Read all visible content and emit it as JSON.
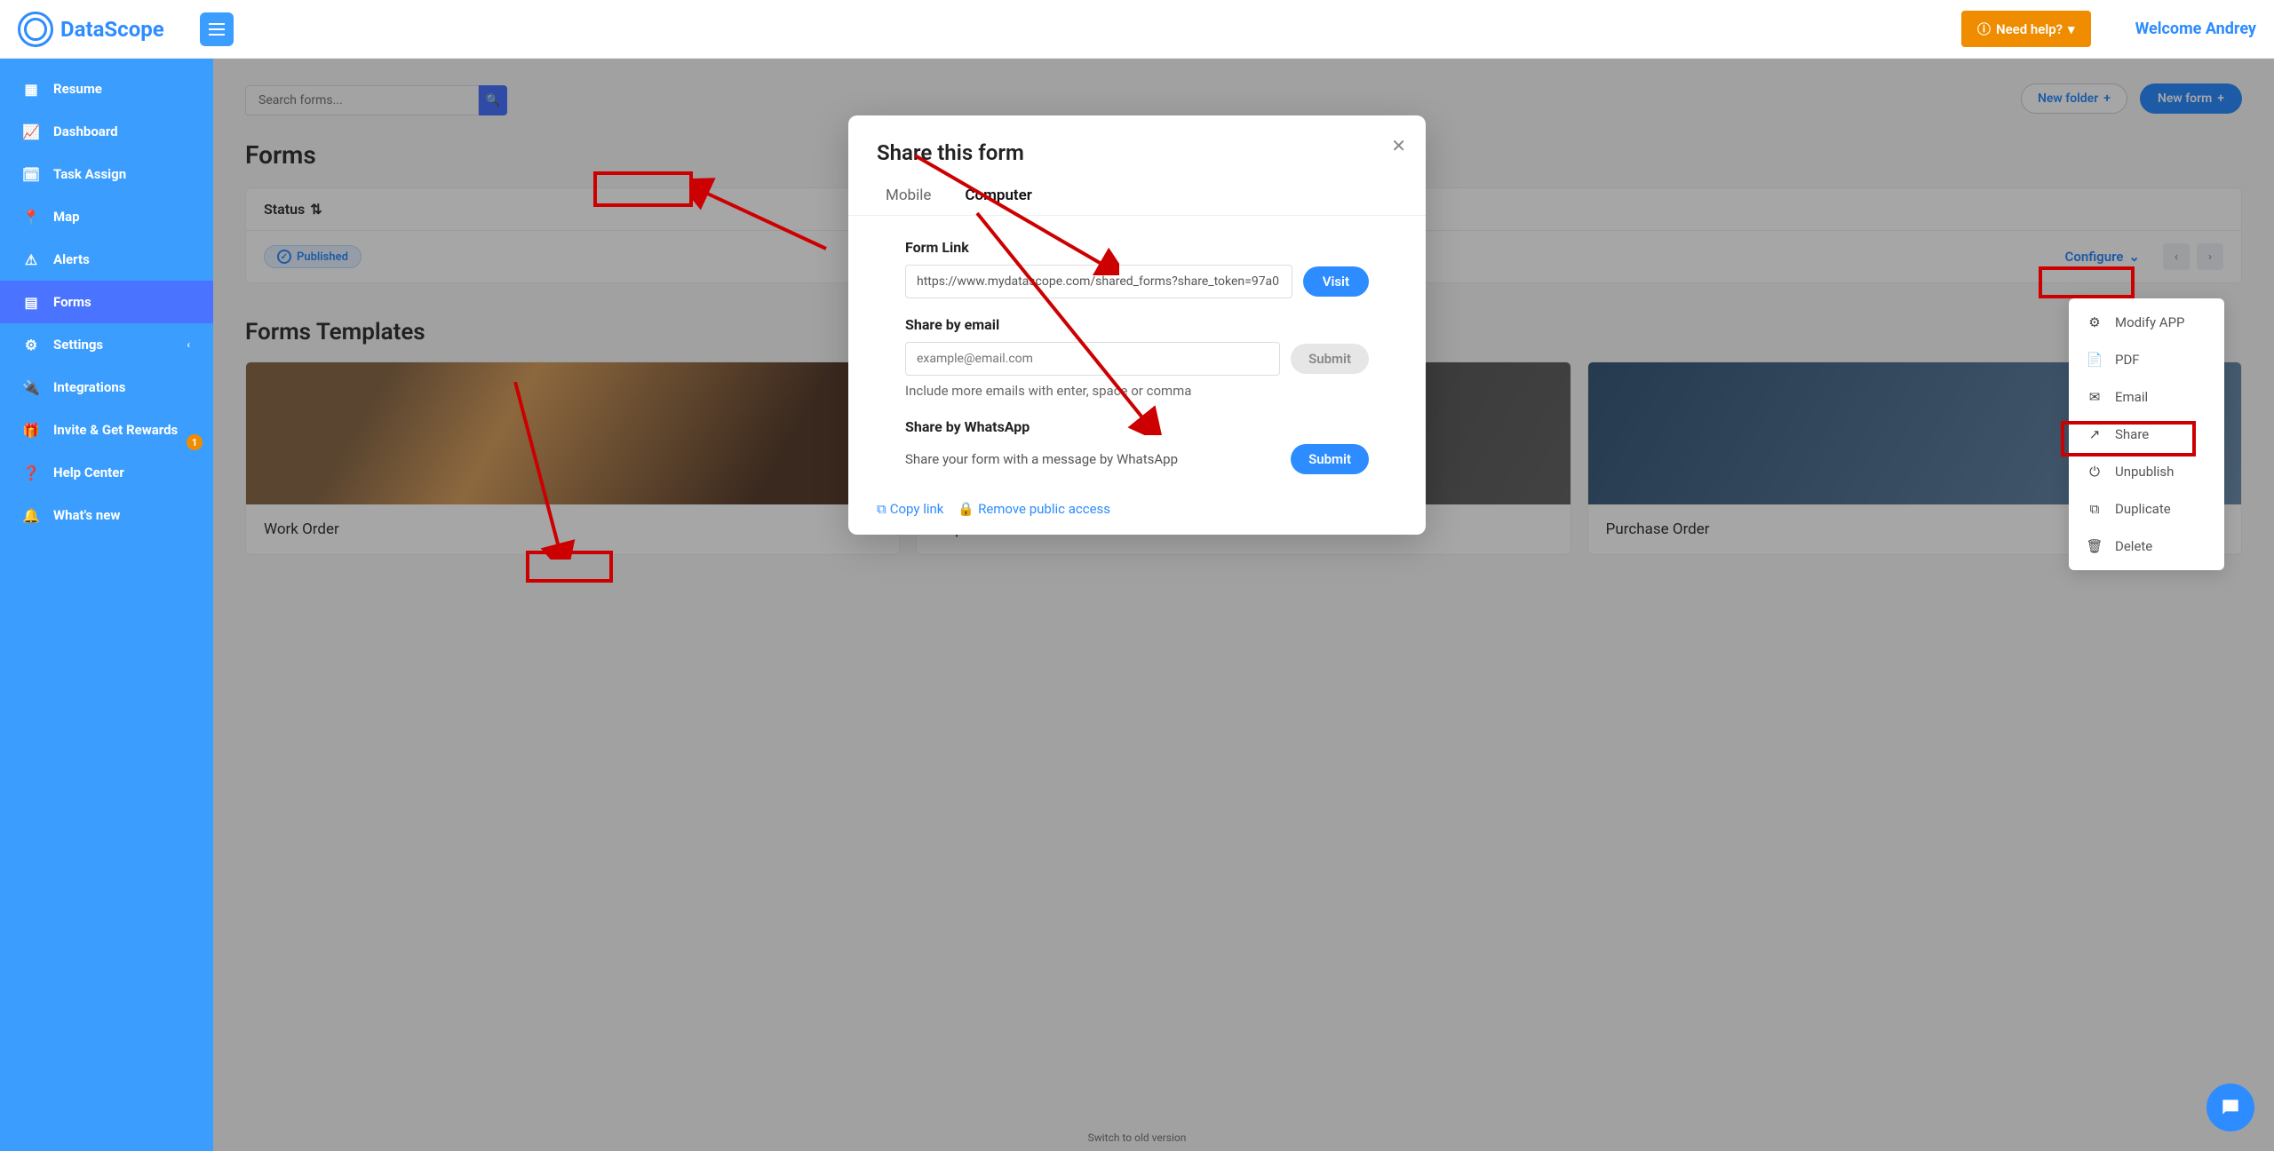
{
  "brand": {
    "name": "DataScope"
  },
  "topbar": {
    "help_label": "Need help?",
    "welcome": "Welcome Andrey"
  },
  "sidebar": {
    "items": [
      {
        "icon": "grid",
        "label": "Resume"
      },
      {
        "icon": "chart",
        "label": "Dashboard"
      },
      {
        "icon": "calendar",
        "label": "Task Assign"
      },
      {
        "icon": "pin",
        "label": "Map"
      },
      {
        "icon": "warning",
        "label": "Alerts"
      },
      {
        "icon": "form",
        "label": "Forms",
        "active": true
      },
      {
        "icon": "gear",
        "label": "Settings",
        "expandable": true
      },
      {
        "icon": "plug",
        "label": "Integrations"
      },
      {
        "icon": "gift",
        "label": "Invite & Get Rewards"
      },
      {
        "icon": "help",
        "label": "Help Center",
        "badge": "1"
      },
      {
        "icon": "bell",
        "label": "What's new"
      }
    ]
  },
  "search": {
    "placeholder": "Search forms..."
  },
  "page": {
    "title": "Forms",
    "new_folder": "New folder",
    "new_form": "New form",
    "status_header": "Status",
    "published_pill": "Published",
    "configure": "Configure",
    "templates_title": "Forms Templates",
    "templates": [
      {
        "label": "Work Order"
      },
      {
        "label": "Inspection"
      },
      {
        "label": "Purchase Order"
      }
    ]
  },
  "modal": {
    "title": "Share this form",
    "tabs": {
      "mobile": "Mobile",
      "computer": "Computer"
    },
    "form_link_label": "Form Link",
    "form_link_value": "https://www.mydatascope.com/shared_forms?share_token=97a0",
    "visit": "Visit",
    "share_email_label": "Share by email",
    "email_placeholder": "example@email.com",
    "submit": "Submit",
    "email_hint": "Include more emails with enter, space or comma",
    "share_whatsapp_label": "Share by WhatsApp",
    "whatsapp_text": "Share your form with a message by WhatsApp",
    "copy_link": "Copy link",
    "remove_access": "Remove public access"
  },
  "config_menu": {
    "items": [
      {
        "icon": "gear",
        "label": "Modify APP"
      },
      {
        "icon": "pdf",
        "label": "PDF"
      },
      {
        "icon": "mail",
        "label": "Email"
      },
      {
        "icon": "share",
        "label": "Share"
      },
      {
        "icon": "power",
        "label": "Unpublish"
      },
      {
        "icon": "copy",
        "label": "Duplicate"
      },
      {
        "icon": "trash",
        "label": "Delete"
      }
    ]
  },
  "footer": {
    "old_version": "Switch to old version"
  }
}
